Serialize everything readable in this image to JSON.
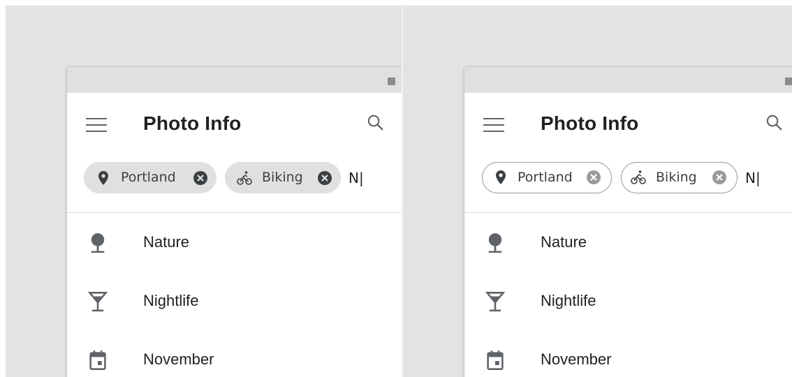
{
  "app": {
    "title": "Photo Info",
    "menu_icon": "hamburger-menu-icon",
    "search_icon": "search-icon"
  },
  "variants": [
    {
      "chip_style": "filled",
      "chips": [
        {
          "label": "Portland",
          "icon": "location-pin-icon"
        },
        {
          "label": "Biking",
          "icon": "bike-icon"
        }
      ],
      "typed_text": "N|"
    },
    {
      "chip_style": "outlined",
      "chips": [
        {
          "label": "Portland",
          "icon": "location-pin-icon"
        },
        {
          "label": "Biking",
          "icon": "bike-icon"
        }
      ],
      "typed_text": "N|"
    }
  ],
  "suggestions": [
    {
      "label": "Nature",
      "icon": "tree-icon"
    },
    {
      "label": "Nightlife",
      "icon": "cocktail-icon"
    },
    {
      "label": "November",
      "icon": "calendar-icon"
    }
  ],
  "colors": {
    "background": "#e3e3e3",
    "chip_fill": "#e0e0e0",
    "chip_outline": "#9a9a9a",
    "icon_gray": "#5f6368",
    "text": "#202124"
  }
}
